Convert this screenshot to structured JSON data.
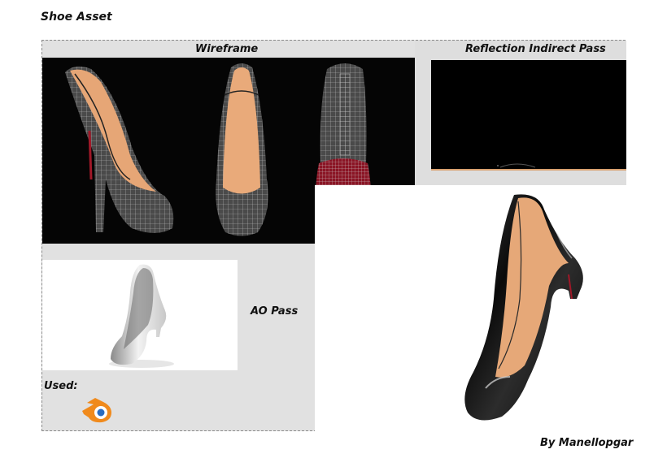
{
  "page": {
    "title": "Shoe Asset",
    "credit": "By Manellopgar"
  },
  "panels": {
    "wireframe": {
      "title": "Wireframe"
    },
    "reflection": {
      "title": "Reflection Indirect Pass"
    },
    "ao": {
      "title": "AO Pass"
    },
    "used": {
      "label": "Used:"
    }
  },
  "icons": {
    "blender": "blender-logo-icon"
  },
  "colors": {
    "frame_bg": "#e1e1e1",
    "wire_bg": "#050505",
    "lining": "#e8a878",
    "sole_red": "#b02030",
    "patent_black": "#0b0b0b",
    "blender_orange": "#f08a1c",
    "blender_blue": "#2a6cbf"
  }
}
